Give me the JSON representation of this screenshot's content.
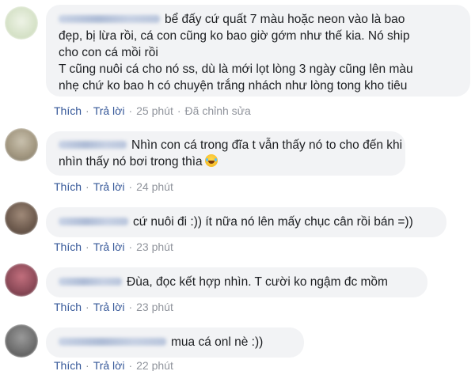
{
  "comments": [
    {
      "lines": [
        "bể đấy cứ quất 7 màu hoặc neon vào là bao",
        "đẹp, bị lừa rồi, cá con cũng ko bao giờ gớm như thế kia. Nó ship",
        "cho con cá mồi rồi",
        "T cũng nuôi cá cho nó ss, dù là mới lọt lòng 3 ngày cũng lên màu",
        "nhẹ chứ ko bao h có chuyện trắng nhách như lòng tong kho tiêu"
      ],
      "like_label": "Thích",
      "reply_label": "Trả lời",
      "time": "25 phút",
      "edited": "Đã chỉnh sửa",
      "avatar_color": "#dfe8d2"
    },
    {
      "lines": [
        "Nhìn con cá trong đĩa t vẫn thấy nó to cho đến khi",
        "nhìn thấy nó bơi trong thìa"
      ],
      "emoji": "laughing-tears-emoji",
      "like_label": "Thích",
      "reply_label": "Trả lời",
      "time": "24 phút",
      "avatar_color": "#a99f8a"
    },
    {
      "lines": [
        "cứ nuôi đi :)) ít nữa nó lên mấy chục cân rồi bán =))"
      ],
      "like_label": "Thích",
      "reply_label": "Trả lời",
      "time": "23 phút",
      "avatar_color": "#7e6a5c"
    },
    {
      "lines": [
        "Đùa, đọc kết hợp nhìn. T cười ko ngậm đc mồm"
      ],
      "like_label": "Thích",
      "reply_label": "Trả lời",
      "time": "23 phút",
      "avatar_color": "#8f4c5a"
    },
    {
      "lines": [
        "mua cá onl nè :))"
      ],
      "like_label": "Thích",
      "reply_label": "Trả lời",
      "time": "22 phút",
      "avatar_color": "#6f6f6f"
    }
  ]
}
